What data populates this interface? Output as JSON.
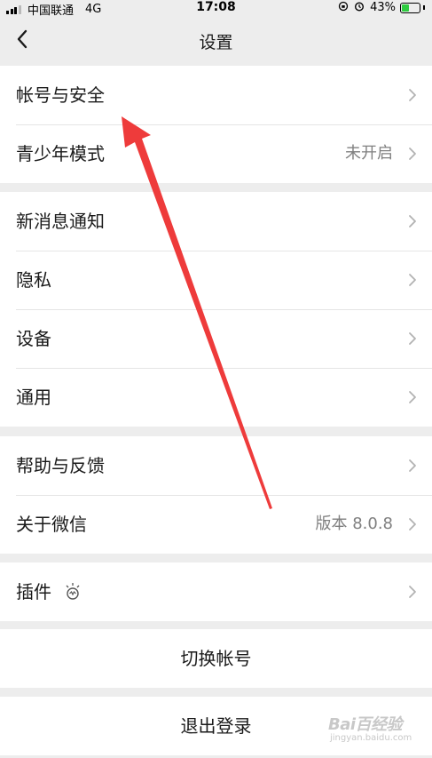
{
  "status_bar": {
    "carrier": "中国联通",
    "network": "4G",
    "time": "17:08",
    "battery_percent": "43%"
  },
  "nav": {
    "title": "设置"
  },
  "groups": {
    "account": {
      "security": {
        "label": "帐号与安全"
      },
      "teen_mode": {
        "label": "青少年模式",
        "value": "未开启"
      }
    },
    "general": {
      "notifications": {
        "label": "新消息通知"
      },
      "privacy": {
        "label": "隐私"
      },
      "devices": {
        "label": "设备"
      },
      "general": {
        "label": "通用"
      }
    },
    "help": {
      "feedback": {
        "label": "帮助与反馈"
      },
      "about": {
        "label": "关于微信",
        "value": "版本 8.0.8"
      }
    },
    "plugins": {
      "plugins": {
        "label": "插件",
        "icon": "plugin-lightbulb-icon"
      }
    }
  },
  "actions": {
    "switch_account": "切换帐号",
    "logout": "退出登录"
  },
  "watermark": {
    "main": "Bai百经验",
    "sub": "jingyan.baidu.com"
  },
  "colors": {
    "background": "#ededed",
    "card": "#ffffff",
    "secondary_text": "#808080",
    "annotation_arrow": "#ee3b3b",
    "battery_fill": "#2ecc40"
  }
}
